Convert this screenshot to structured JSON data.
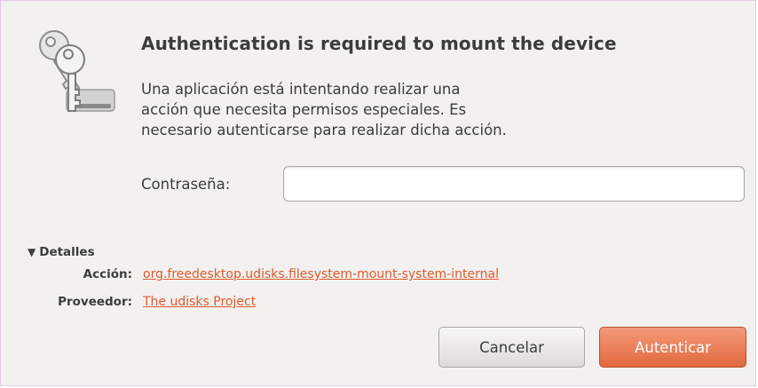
{
  "dialog": {
    "title": "Authentication is required to mount the device",
    "message_lines": [
      "Una aplicación está intentando realizar una",
      "acción que necesita permisos especiales. Es",
      "necesario autenticarse para realizar dicha acción."
    ],
    "icon": "keys-icon"
  },
  "password": {
    "label": "Contraseña:",
    "value": ""
  },
  "details": {
    "toggle_glyph": "▼",
    "toggle_label": "Detalles",
    "action_label": "Acción:",
    "action_value": "org.freedesktop.udisks.filesystem-mount-system-internal",
    "vendor_label": "Proveedor:",
    "vendor_value": "The udisks Project"
  },
  "buttons": {
    "cancel": "Cancelar",
    "authenticate": "Autenticar"
  },
  "colors": {
    "accent": "#e2693e",
    "link": "#e05a2b",
    "background": "#f2f1f0"
  }
}
